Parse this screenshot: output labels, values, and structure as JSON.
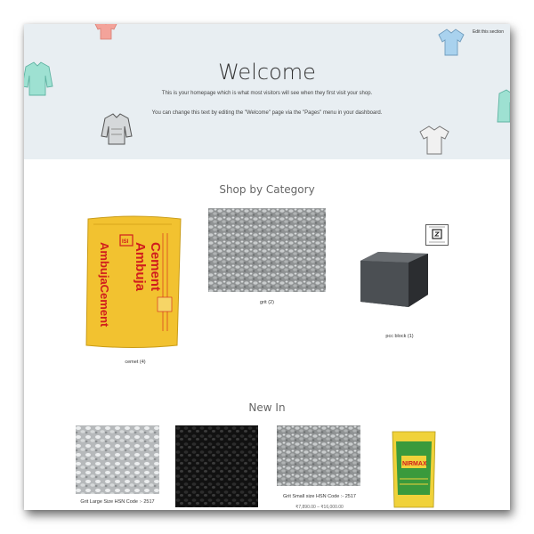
{
  "hero": {
    "edit_link": "Edit this section",
    "title": "Welcome",
    "paragraph1": "This is your homepage which is what most visitors will see when they first visit your shop.",
    "paragraph2": "You can change this text by editing the \"Welcome\" page via the \"Pages\" menu in your dashboard."
  },
  "shop_by_category": {
    "heading": "Shop by Category",
    "categories": [
      {
        "name": "cemet",
        "count": "(4)",
        "image": "ambuja-cement-bag"
      },
      {
        "name": "grit",
        "count": "(2)",
        "image": "grit-gravel"
      },
      {
        "name": "pcc block",
        "count": "(1)",
        "image": "concrete-block"
      }
    ]
  },
  "cement_bag": {
    "line1": "Ambuja",
    "line2": "Cement",
    "side": "AmbujaCement",
    "isi": "ISI"
  },
  "new_in": {
    "heading": "New In",
    "products": [
      {
        "title": "Grit Large Size HSN Code :- 2517",
        "image": "light-gravel"
      },
      {
        "title": "",
        "image": "black-gravel"
      },
      {
        "title": "Grit Small size HSN Code :- 2517",
        "price": "₹7,890.00 – ₹16,000.00",
        "image": "grey-gravel"
      },
      {
        "title": "",
        "image": "nirmax-cement-bag",
        "brand": "NIRMAX"
      }
    ]
  },
  "colors": {
    "hero_bg": "#e8eef2",
    "bag_yellow": "#f2c230",
    "bag_text": "#d11d1d"
  }
}
